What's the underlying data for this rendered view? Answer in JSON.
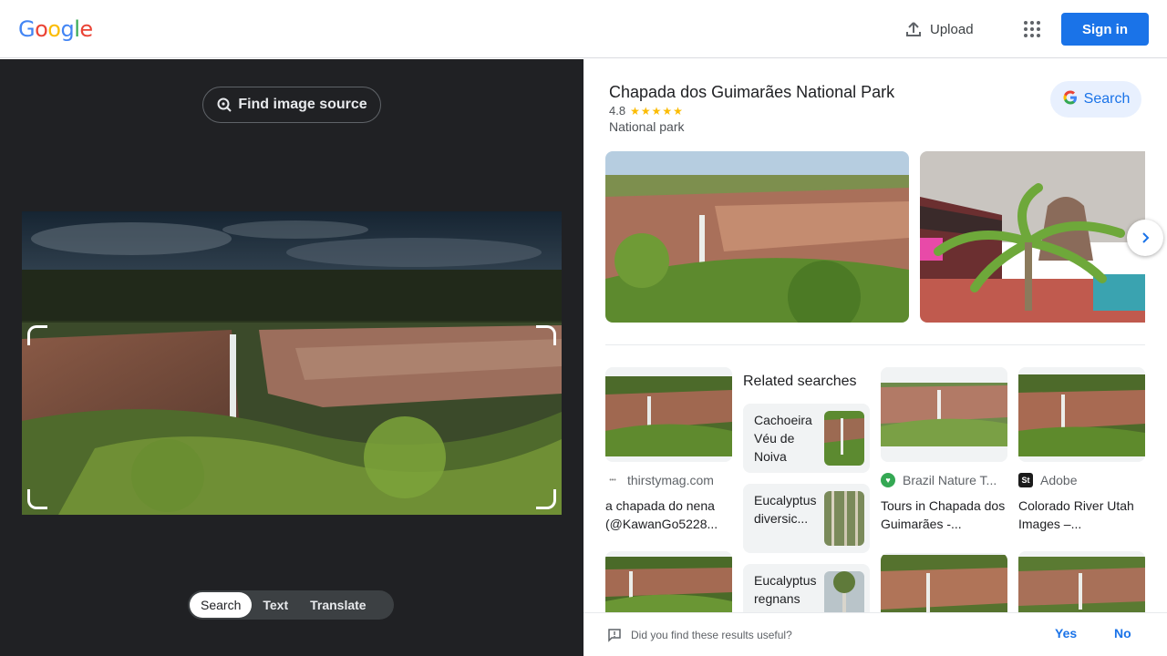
{
  "header": {
    "logo_letters": [
      "G",
      "o",
      "o",
      "g",
      "l",
      "e"
    ],
    "upload_label": "Upload",
    "signin_label": "Sign in"
  },
  "lens": {
    "find_source_label": "Find image source",
    "tabs": [
      {
        "label": "Search",
        "active": true
      },
      {
        "label": "Text",
        "active": false
      },
      {
        "label": "Translate",
        "active": false
      }
    ]
  },
  "knowledge_panel": {
    "title": "Chapada dos Guimarães National Park",
    "rating": "4.8",
    "stars": "★★★★★",
    "type": "National park",
    "search_label": "Search",
    "next_icon": "chevron-right-icon"
  },
  "related": {
    "heading": "Related searches",
    "items": [
      {
        "label": "Cachoeira Véu de Noiva"
      },
      {
        "label": "Eucalyptus diversic..."
      },
      {
        "label": "Eucalyptus regnans"
      }
    ]
  },
  "results": [
    {
      "source": "thirstymag.com",
      "title": "a chapada do nena (@KawanGo5228..."
    },
    {
      "source": "Brazil Nature T...",
      "title": "Tours in Chapada dos Guimarães -..."
    },
    {
      "source": "Adobe",
      "title": "Colorado River Utah Images –..."
    }
  ],
  "feedback": {
    "question": "Did you find these results useful?",
    "yes": "Yes",
    "no": "No"
  },
  "colors": {
    "google_blue": "#4285f4",
    "google_red": "#ea4335",
    "google_yellow": "#fbbc04",
    "google_green": "#34a853",
    "accent": "#1a73e8",
    "dark_panel": "#202124"
  }
}
